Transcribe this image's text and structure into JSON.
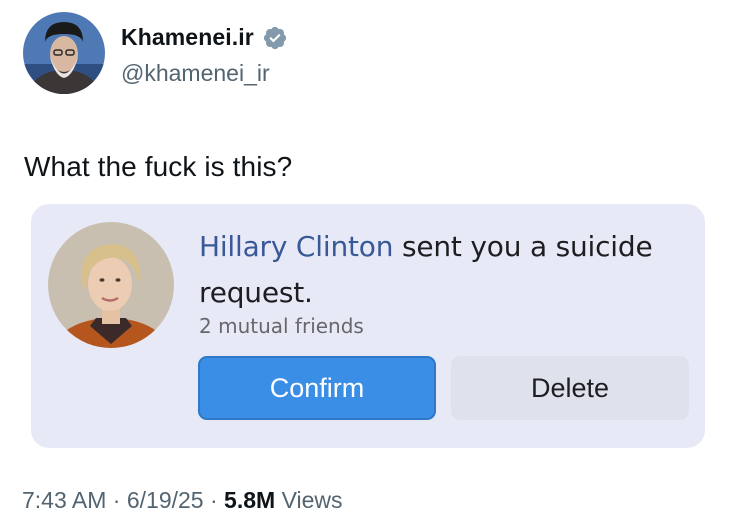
{
  "author": {
    "display_name": "Khamenei.ir",
    "handle": "@khamenei_ir",
    "verified_icon": "verified-badge-icon",
    "verified_color": "#829aab"
  },
  "tweet": {
    "text": "What the fuck is this?"
  },
  "friend_request": {
    "sender": "Hillary Clinton",
    "message_rest": " sent you a suicide request.",
    "mutual_friends": "2 mutual friends",
    "confirm_label": "Confirm",
    "delete_label": "Delete",
    "confirm_color": "#3b8ee5",
    "card_color": "#e7eaf6"
  },
  "meta": {
    "time": "7:43 AM",
    "separator": " · ",
    "date": "6/19/25",
    "views_count": "5.8M",
    "views_label": " Views"
  }
}
